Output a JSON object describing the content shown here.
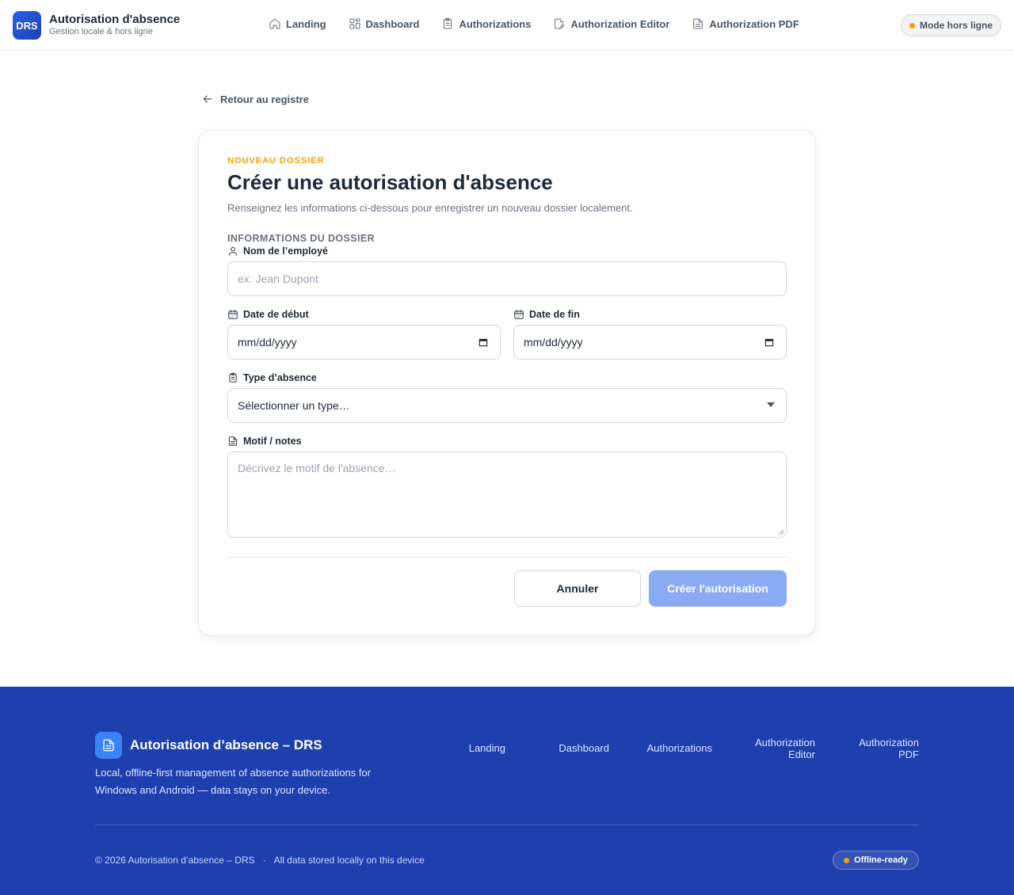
{
  "header": {
    "logo_text": "DRS",
    "title": "Autorisation d'absence",
    "subtitle": "Gestion locale & hors ligne",
    "nav": [
      {
        "label": "Landing",
        "icon": "home-icon"
      },
      {
        "label": "Dashboard",
        "icon": "dashboard-icon"
      },
      {
        "label": "Authorizations",
        "icon": "clipboard-icon"
      },
      {
        "label": "Authorization Editor",
        "icon": "edit-document-icon"
      },
      {
        "label": "Authorization PDF",
        "icon": "document-icon"
      }
    ],
    "status_label": "Mode hors ligne"
  },
  "back_link": "Retour au registre",
  "form": {
    "eyebrow": "NOUVEAU DOSSIER",
    "title": "Créer une autorisation d'absence",
    "description": "Renseignez les informations ci-dessous pour enregistrer un nouveau dossier localement.",
    "section_title": "INFORMATIONS DU DOSSIER",
    "employee_label": "Nom de l’employé",
    "employee_placeholder": "ex. Jean Dupont",
    "start_label": "Date de début",
    "start_value": "mm/dd/yyyy",
    "end_label": "Date de fin",
    "end_value": "mm/dd/yyyy",
    "type_label": "Type d’absence",
    "type_value": "Sélectionner un type…",
    "notes_label": "Motif / notes",
    "notes_placeholder": "Décrivez le motif de l'absence…",
    "cancel_label": "Annuler",
    "submit_label": "Créer l'autorisation"
  },
  "footer": {
    "title": "Autorisation d’absence – DRS",
    "description": "Local, offline-first management of absence authorizations for Windows and Android — data stays on your device.",
    "links": [
      "Landing",
      "Dashboard",
      "Authorizations",
      "Authorization\nEditor",
      "Authorization\nPDF"
    ],
    "copyright": "© 2026 Autorisation d’absence – DRS",
    "separator": "·",
    "storage_note": "All data stored locally on this device",
    "badge": "Offline-ready"
  },
  "colors": {
    "accent": "#2563eb",
    "footer_bg": "#1e40af",
    "status_dot": "#f59e0b",
    "eyebrow": "#f59e0b"
  }
}
